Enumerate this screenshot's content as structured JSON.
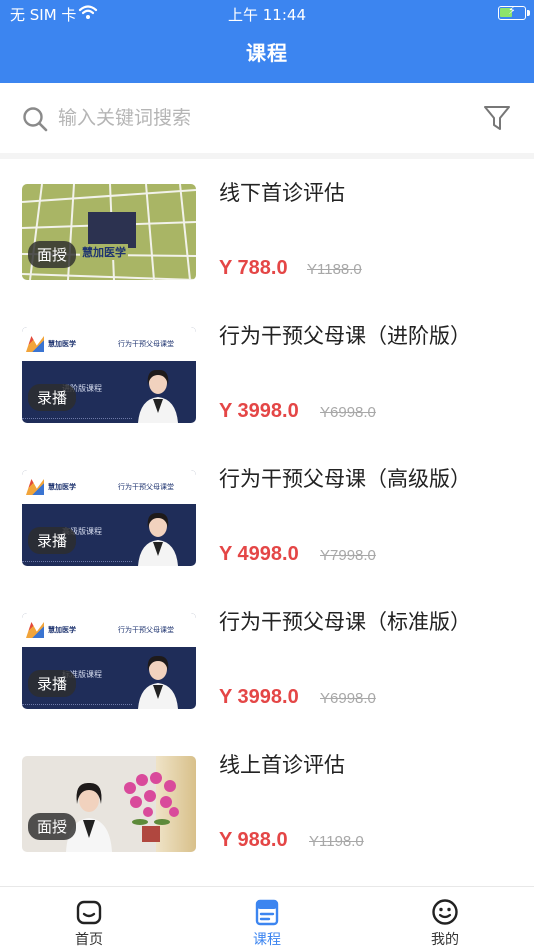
{
  "status_bar": {
    "carrier": "无 SIM 卡",
    "time": "上午 11:44"
  },
  "header": {
    "title": "课程"
  },
  "search": {
    "placeholder": "输入关键词搜索"
  },
  "courses": [
    {
      "title": "线下首诊评估",
      "badge": "面授",
      "price": "Y 788.0",
      "original_price": "Y1188.0",
      "logo_text": "慧加医学"
    },
    {
      "title": "行为干预父母课（进阶版）",
      "badge": "录播",
      "price": "Y 3998.0",
      "original_price": "Y6998.0",
      "brand": "慧加医学",
      "series": "行为干预父母课堂",
      "subtitle": "进阶版课程"
    },
    {
      "title": "行为干预父母课（高级版）",
      "badge": "录播",
      "price": "Y 4998.0",
      "original_price": "Y7998.0",
      "brand": "慧加医学",
      "series": "行为干预父母课堂",
      "subtitle": "高级版课程"
    },
    {
      "title": "行为干预父母课（标准版）",
      "badge": "录播",
      "price": "Y 3998.0",
      "original_price": "Y6998.0",
      "brand": "慧加医学",
      "series": "行为干预父母课堂",
      "subtitle": "标准版课程"
    },
    {
      "title": "线上首诊评估",
      "badge": "面授",
      "price": "Y 988.0",
      "original_price": "Y1198.0"
    }
  ],
  "tabs": [
    {
      "label": "首页",
      "icon": "home-icon"
    },
    {
      "label": "课程",
      "icon": "course-icon"
    },
    {
      "label": "我的",
      "icon": "profile-icon"
    }
  ],
  "colors": {
    "brand": "#3c85f0",
    "price": "#e44646",
    "original_price": "#a8a8a8"
  }
}
